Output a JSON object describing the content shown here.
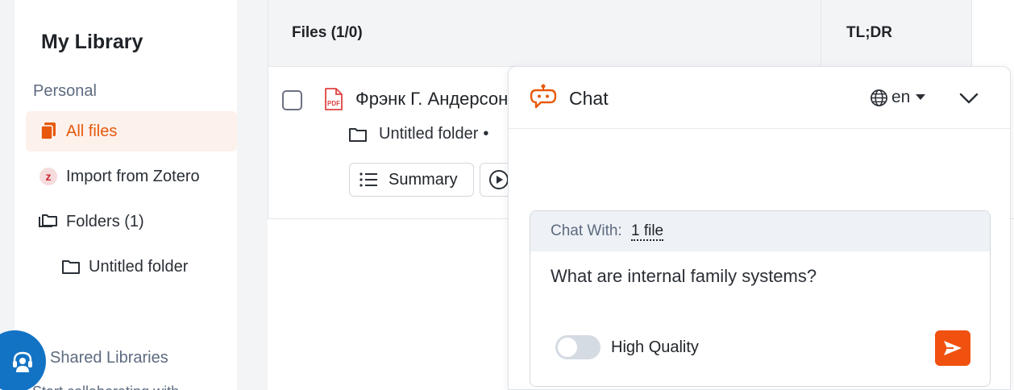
{
  "sidebar": {
    "title": "My Library",
    "personal_label": "Personal",
    "items": [
      {
        "label": "All files",
        "icon": "files-icon"
      },
      {
        "label": "Import from Zotero",
        "icon": "zotero-icon"
      },
      {
        "label": "Folders (1)",
        "icon": "folders-icon"
      },
      {
        "label": "Untitled folder",
        "icon": "folder-icon"
      }
    ],
    "shared_label": "Shared Libraries",
    "shared_text": "Start collaborating with"
  },
  "table": {
    "files_header": "Files (1/0)",
    "tldr_header": "TL;DR",
    "row": {
      "title": "Фрэнк Г. Андерсон",
      "folder": "Untitled folder",
      "summary_button": "Summary"
    }
  },
  "chat": {
    "title": "Chat",
    "language": "en",
    "chat_with_label": "Chat With:",
    "chat_with_files": "1 file",
    "question": "What are internal family systems?",
    "high_quality_label": "High Quality",
    "high_quality_on": false
  },
  "colors": {
    "accent": "#e8590c",
    "send_button": "#f0510f",
    "support_bubble": "#1273c5"
  }
}
